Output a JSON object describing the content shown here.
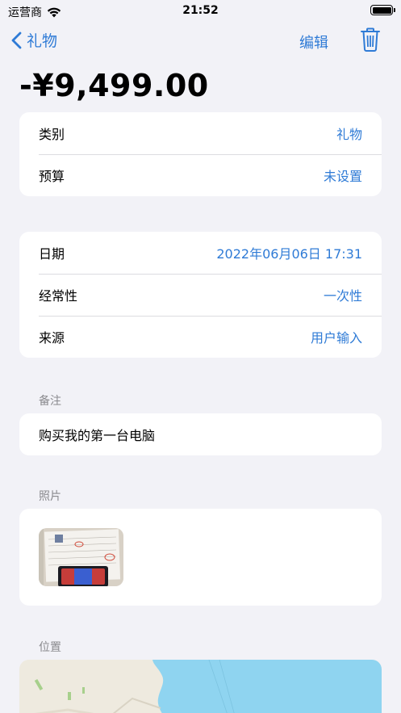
{
  "status": {
    "carrier": "运营商",
    "time": "21:52"
  },
  "nav": {
    "back_label": "礼物",
    "edit_label": "编辑"
  },
  "amount": "-¥9,499.00",
  "details": [
    {
      "label": "类别",
      "value": "礼物"
    },
    {
      "label": "预算",
      "value": "未设置"
    }
  ],
  "meta": [
    {
      "label": "日期",
      "value": "2022年06月06日 17:31"
    },
    {
      "label": "经常性",
      "value": "一次性"
    },
    {
      "label": "来源",
      "value": "用户输入"
    }
  ],
  "note": {
    "header": "备注",
    "text": "购买我的第一台电脑"
  },
  "photos": {
    "header": "照片"
  },
  "location": {
    "header": "位置"
  },
  "colors": {
    "accent": "#2f7bd6",
    "background": "#f2f2f7",
    "card": "#ffffff"
  }
}
